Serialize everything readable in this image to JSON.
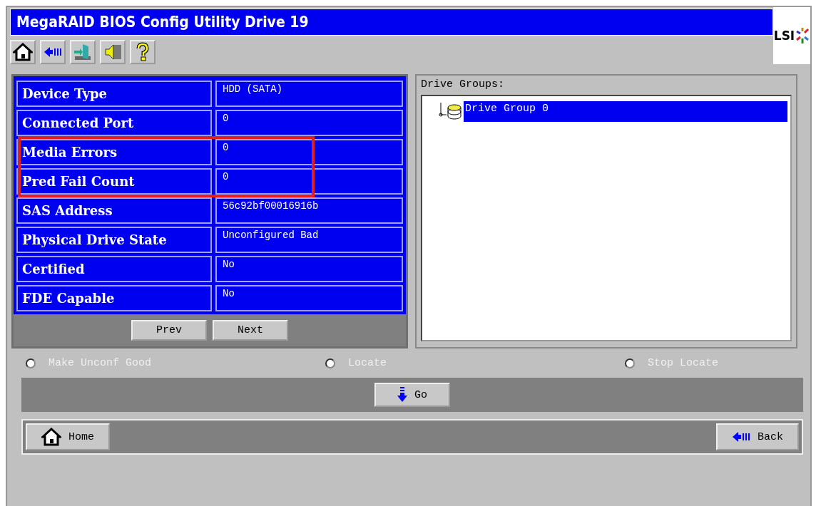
{
  "window": {
    "title": "MegaRAID BIOS Config Utility Drive 19",
    "logo": "LSI"
  },
  "toolbar": [
    {
      "kind": "home"
    },
    {
      "kind": "back"
    },
    {
      "kind": "exit"
    },
    {
      "kind": "sound"
    },
    {
      "kind": "help"
    }
  ],
  "properties": [
    {
      "label": "Device Type",
      "value": "HDD (SATA)",
      "highlighted": false
    },
    {
      "label": "Connected Port",
      "value": "0",
      "highlighted": false
    },
    {
      "label": "Media Errors",
      "value": "0",
      "highlighted": true
    },
    {
      "label": "Pred Fail Count",
      "value": "0",
      "highlighted": true
    },
    {
      "label": "SAS Address",
      "value": "56c92bf00016916b",
      "highlighted": false
    },
    {
      "label": "Physical Drive State",
      "value": "Unconfigured Bad",
      "highlighted": false
    },
    {
      "label": "Certified",
      "value": "No",
      "highlighted": false
    },
    {
      "label": "FDE Capable",
      "value": "No",
      "highlighted": false
    }
  ],
  "pager": [
    "Prev",
    "Next"
  ],
  "drive_groups": {
    "label": "Drive Groups:",
    "items": [
      {
        "label": "Drive Group 0",
        "selected": true
      }
    ]
  },
  "actions": [
    {
      "label": "Make Unconf Good",
      "selected": false,
      "disabled": true
    },
    {
      "label": "Locate",
      "selected": false,
      "disabled": true
    },
    {
      "label": "Stop Locate",
      "selected": false,
      "disabled": true
    }
  ],
  "go_button": "Go",
  "nav": {
    "home": "Home",
    "back": "Back"
  }
}
